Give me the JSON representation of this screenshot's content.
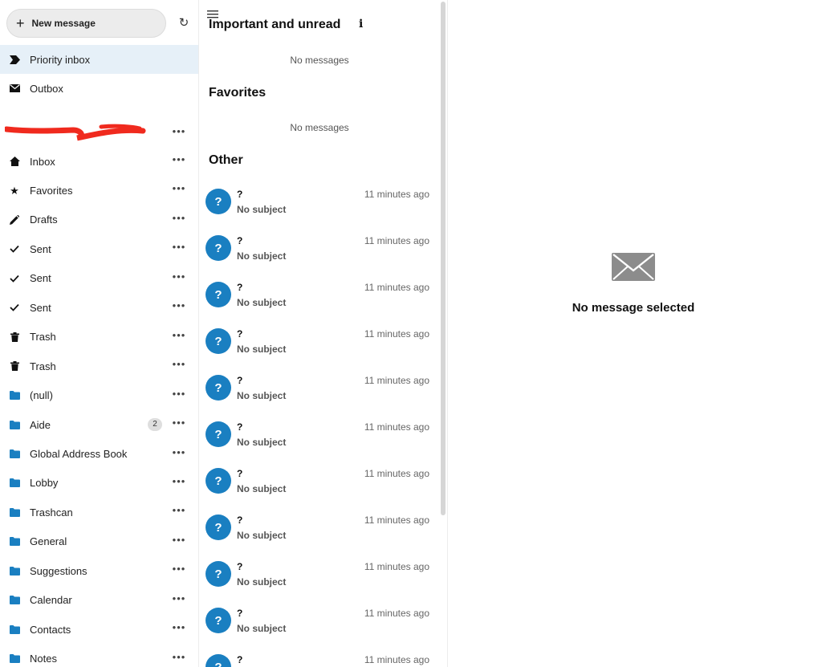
{
  "sidebar": {
    "new_message": "New message",
    "priority_inbox": "Priority inbox",
    "outbox": "Outbox",
    "folders": [
      {
        "label": "Inbox",
        "icon": "home-icon"
      },
      {
        "label": "Favorites",
        "icon": "star-icon"
      },
      {
        "label": "Drafts",
        "icon": "pencil-icon"
      },
      {
        "label": "Sent",
        "icon": "check-icon"
      },
      {
        "label": "Sent",
        "icon": "check-icon"
      },
      {
        "label": "Sent",
        "icon": "check-icon"
      },
      {
        "label": "Trash",
        "icon": "trash-icon"
      },
      {
        "label": "Trash",
        "icon": "trash-icon"
      },
      {
        "label": "(null)",
        "icon": "folder-icon"
      },
      {
        "label": "Aide",
        "icon": "folder-icon",
        "count": "2"
      },
      {
        "label": "Global Address Book",
        "icon": "folder-icon"
      },
      {
        "label": "Lobby",
        "icon": "folder-icon"
      },
      {
        "label": "Trashcan",
        "icon": "folder-icon"
      },
      {
        "label": "General",
        "icon": "folder-icon"
      },
      {
        "label": "Suggestions",
        "icon": "folder-icon"
      },
      {
        "label": "Calendar",
        "icon": "folder-icon"
      },
      {
        "label": "Contacts",
        "icon": "folder-icon"
      },
      {
        "label": "Notes",
        "icon": "folder-icon"
      }
    ],
    "colors": {
      "active_bg": "#e6f0f8",
      "folder": "#1a7fc1",
      "redaction": "#f02a1e"
    }
  },
  "list": {
    "important_title": "Important and unread",
    "important_empty": "No messages",
    "favorites_title": "Favorites",
    "favorites_empty": "No messages",
    "other_title": "Other",
    "messages": [
      {
        "avatar": "?",
        "sender": "?",
        "subject": "No subject",
        "time": "11 minutes ago"
      },
      {
        "avatar": "?",
        "sender": "?",
        "subject": "No subject",
        "time": "11 minutes ago"
      },
      {
        "avatar": "?",
        "sender": "?",
        "subject": "No subject",
        "time": "11 minutes ago"
      },
      {
        "avatar": "?",
        "sender": "?",
        "subject": "No subject",
        "time": "11 minutes ago"
      },
      {
        "avatar": "?",
        "sender": "?",
        "subject": "No subject",
        "time": "11 minutes ago"
      },
      {
        "avatar": "?",
        "sender": "?",
        "subject": "No subject",
        "time": "11 minutes ago"
      },
      {
        "avatar": "?",
        "sender": "?",
        "subject": "No subject",
        "time": "11 minutes ago"
      },
      {
        "avatar": "?",
        "sender": "?",
        "subject": "No subject",
        "time": "11 minutes ago"
      },
      {
        "avatar": "?",
        "sender": "?",
        "subject": "No subject",
        "time": "11 minutes ago"
      },
      {
        "avatar": "?",
        "sender": "?",
        "subject": "No subject",
        "time": "11 minutes ago"
      },
      {
        "avatar": "?",
        "sender": "?",
        "subject": "",
        "time": "11 minutes ago"
      }
    ],
    "colors": {
      "avatar_bg": "#1a7fc1"
    }
  },
  "content": {
    "empty_title": "No message selected",
    "icon": "envelope-icon"
  }
}
